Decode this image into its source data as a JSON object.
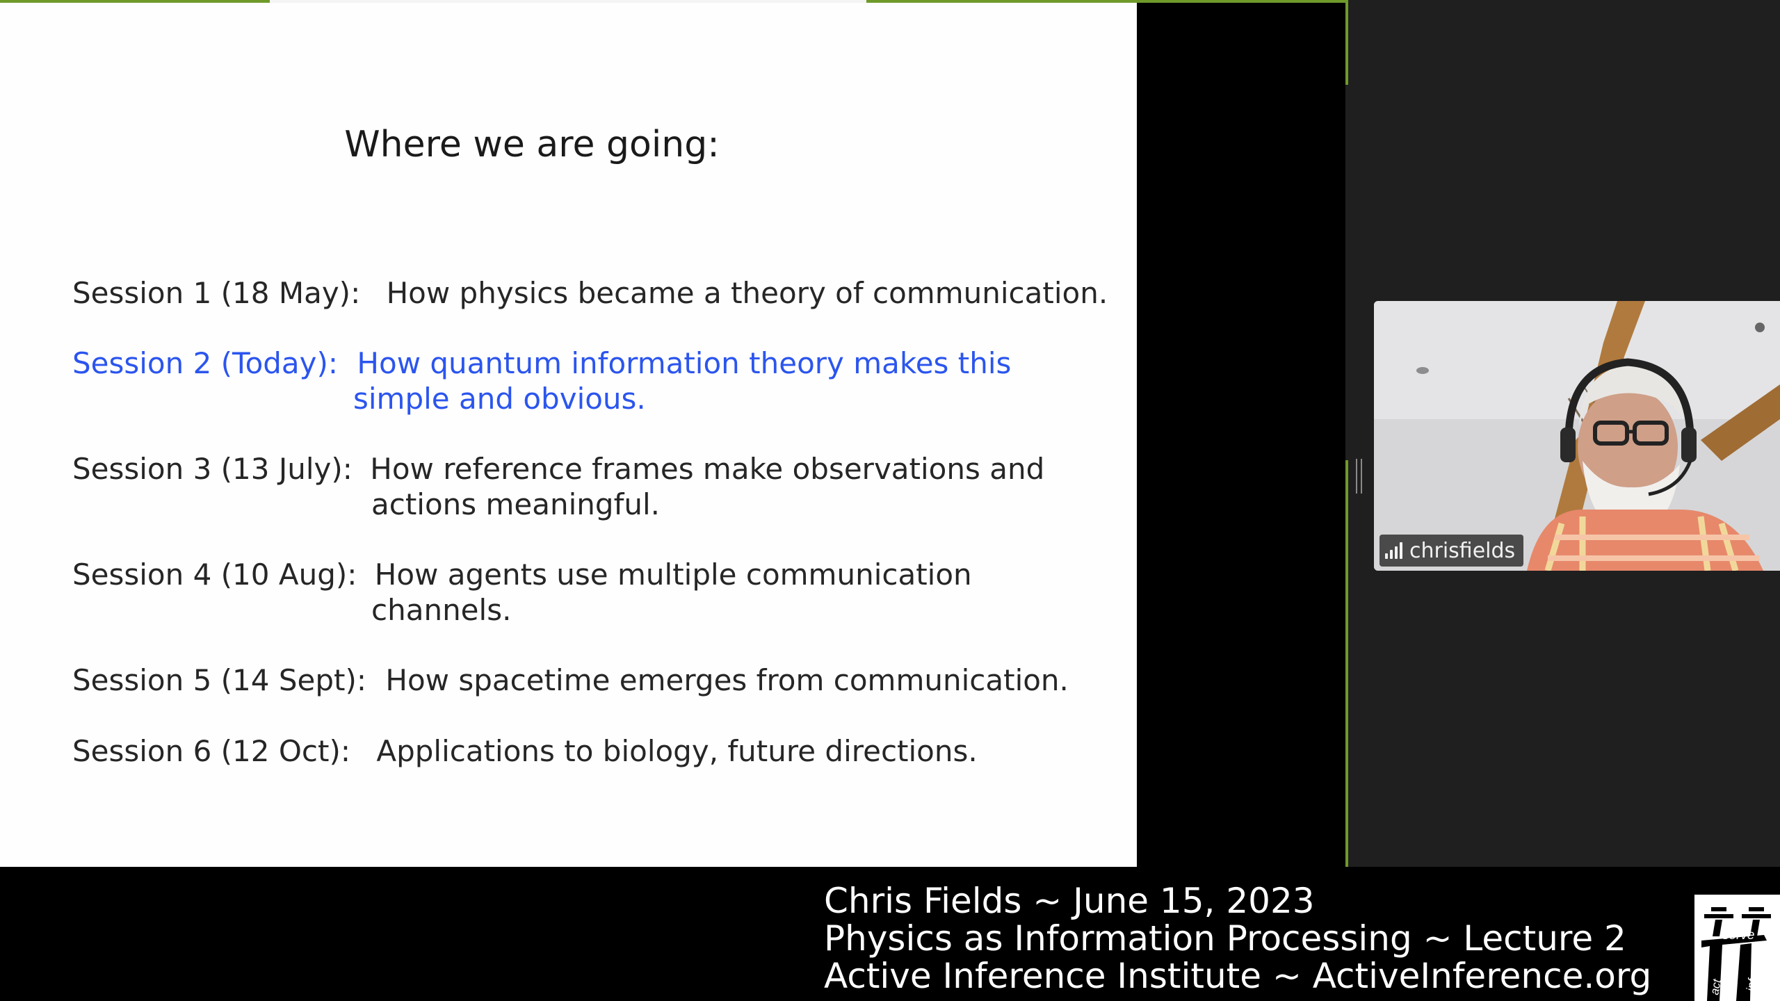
{
  "slide": {
    "title": "Where we are going:",
    "sessions": [
      {
        "label": "Session 1 (18 May):",
        "desc": "How physics became a theory of communication.",
        "cont": ""
      },
      {
        "label": "Session 2 (Today):",
        "desc": "How quantum information theory makes this",
        "cont": "simple and obvious."
      },
      {
        "label": "Session 3 (13 July):",
        "desc": "How reference frames make observations and",
        "cont": "actions meaningful."
      },
      {
        "label": "Session 4 (10 Aug):",
        "desc": "How agents use multiple communication",
        "cont": "channels."
      },
      {
        "label": "Session 5 (14 Sept):",
        "desc": "How spacetime emerges from communication.",
        "cont": ""
      },
      {
        "label": "Session 6 (12 Oct):",
        "desc": "Applications to biology, future directions.",
        "cont": ""
      }
    ],
    "current_session_color": "#2b55ee"
  },
  "participant": {
    "name": "chrisfields",
    "icon": "signal-strength-icon"
  },
  "caption": {
    "line1": "Chris Fields ~ June 15, 2023",
    "line2": "Physics as Information Processing ~ Lecture 2",
    "line3": "Active Inference Institute ~ ActiveInference.org"
  },
  "logo": {
    "text_serve": "serve",
    "text_act": "act",
    "text_infer": "infer"
  },
  "colors": {
    "frame_accent": "#6f9a2a",
    "background": "#1f1f1f"
  }
}
